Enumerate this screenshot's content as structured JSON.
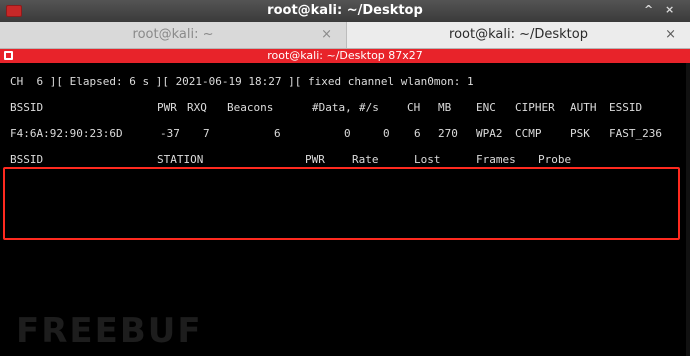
{
  "window": {
    "title": "root@kali: ~/Desktop",
    "controls": [
      "^",
      "×"
    ]
  },
  "tabs": [
    {
      "label": "root@kali: ~",
      "close": "×",
      "active": false
    },
    {
      "label": "root@kali: ~/Desktop",
      "close": "×",
      "active": true
    }
  ],
  "terminal_header": {
    "title": "root@kali: ~/Desktop 87x27"
  },
  "terminal": {
    "status_line": "CH  6 ][ Elapsed: 6 s ][ 2021-06-19 18:27 ][ fixed channel wlan0mon: 1",
    "ap_table": {
      "headers": [
        "BSSID",
        "PWR",
        "RXQ",
        "Beacons",
        "#Data,",
        "#/s",
        "CH",
        "MB",
        "ENC",
        "CIPHER",
        "AUTH",
        "ESSID"
      ],
      "rows": [
        [
          "F4:6A:92:90:23:6D",
          "-37",
          "7",
          "6",
          "0",
          "0",
          "6",
          "270",
          "WPA2",
          "CCMP",
          "PSK",
          "FAST_236"
        ]
      ]
    },
    "station_table": {
      "headers": [
        "BSSID",
        "STATION",
        "PWR",
        "Rate",
        "Lost",
        "Frames",
        "Probe"
      ],
      "rows": []
    }
  },
  "watermark": "FREEBUF",
  "colors": {
    "terminal_bg": "#000000",
    "terminal_text": "#dcdcdc",
    "header_red": "#e8232a",
    "highlight_border": "#ff2a1f"
  }
}
